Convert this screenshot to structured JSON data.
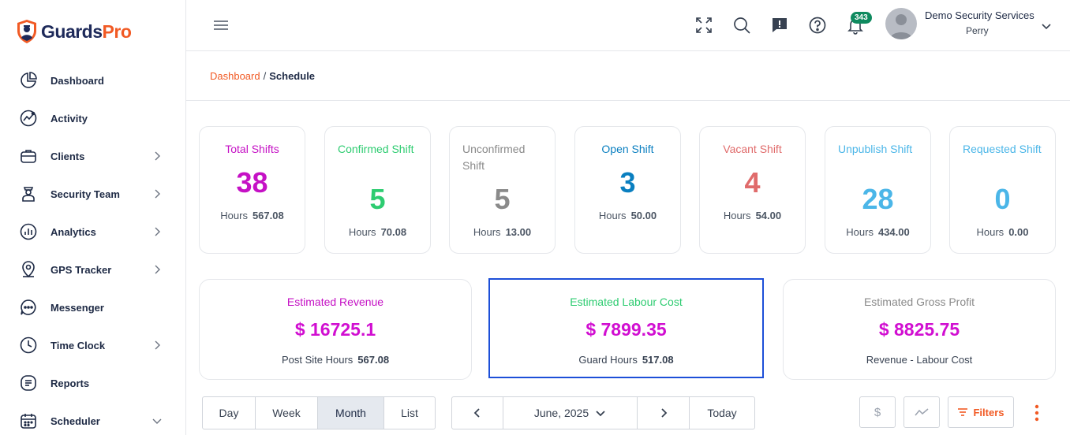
{
  "brand": {
    "name_part1": "Guards",
    "name_part2": "Pro"
  },
  "sidebar": {
    "items": [
      {
        "label": "Dashboard",
        "icon": "pie-chart-icon",
        "chevron": false
      },
      {
        "label": "Activity",
        "icon": "activity-icon",
        "chevron": false
      },
      {
        "label": "Clients",
        "icon": "briefcase-icon",
        "chevron": true
      },
      {
        "label": "Security Team",
        "icon": "guard-icon",
        "chevron": true
      },
      {
        "label": "Analytics",
        "icon": "analytics-icon",
        "chevron": true
      },
      {
        "label": "GPS Tracker",
        "icon": "map-pin-icon",
        "chevron": true
      },
      {
        "label": "Messenger",
        "icon": "chat-icon",
        "chevron": false
      },
      {
        "label": "Time Clock",
        "icon": "clock-icon",
        "chevron": true
      },
      {
        "label": "Reports",
        "icon": "report-icon",
        "chevron": false
      },
      {
        "label": "Scheduler",
        "icon": "calendar-icon",
        "chevron": "down"
      }
    ]
  },
  "header": {
    "notification_count": "343",
    "user_company": "Demo Security Services",
    "user_name": "Perry"
  },
  "breadcrumb": {
    "link": "Dashboard",
    "separator": "/",
    "current": "Schedule"
  },
  "stats": [
    {
      "title": "Total Shifts",
      "value": "38",
      "hours_label": "Hours",
      "hours": "567.08",
      "color": "#c511c5"
    },
    {
      "title": "Confirmed Shift",
      "value": "5",
      "hours_label": "Hours",
      "hours": "70.08",
      "color": "#2ecc71"
    },
    {
      "title": "Unconfirmed Shift",
      "value": "5",
      "hours_label": "Hours",
      "hours": "13.00",
      "color": "#8a8a8a"
    },
    {
      "title": "Open Shift",
      "value": "3",
      "hours_label": "Hours",
      "hours": "50.00",
      "color": "#0a7fc0"
    },
    {
      "title": "Vacant Shift",
      "value": "4",
      "hours_label": "Hours",
      "hours": "54.00",
      "color": "#e06b6b"
    },
    {
      "title": "Unpublish Shift",
      "value": "28",
      "hours_label": "Hours",
      "hours": "434.00",
      "color": "#4bb6e8"
    },
    {
      "title": "Requested Shift",
      "value": "0",
      "hours_label": "Hours",
      "hours": "0.00",
      "color": "#4bb6e8"
    }
  ],
  "summary": [
    {
      "title": "Estimated Revenue",
      "value": "$ 16725.1",
      "sub_label": "Post Site Hours",
      "sub_value": "567.08",
      "title_color": "#c511c5"
    },
    {
      "title": "Estimated Labour Cost",
      "value": "$ 7899.35",
      "sub_label": "Guard Hours",
      "sub_value": "517.08",
      "title_color": "#2ecc71"
    },
    {
      "title": "Estimated Gross Profit",
      "value": "$ 8825.75",
      "sub_label": "Revenue - Labour Cost",
      "sub_value": "",
      "title_color": "#8a8a8a"
    }
  ],
  "toolbar": {
    "views": [
      "Day",
      "Week",
      "Month",
      "List"
    ],
    "active_view": "Month",
    "current_period": "June, 2025",
    "today_label": "Today",
    "filters_label": "Filters",
    "dollar_glyph": "$"
  }
}
